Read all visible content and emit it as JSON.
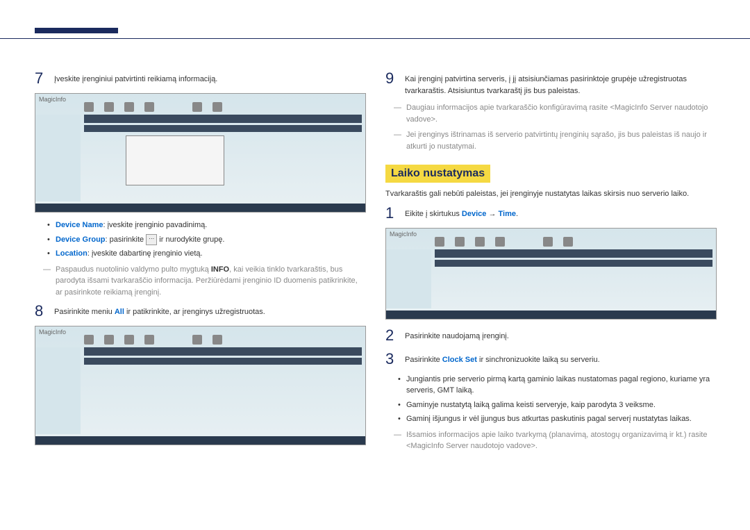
{
  "left": {
    "s7": {
      "num": "7",
      "txt": "Įveskite įrenginiui patvirtinti reikiamą informaciją."
    },
    "b1_a": "Device Name",
    "b1_b": ": įveskite įrenginio pavadinimą.",
    "b2_a": "Device Group",
    "b2_b": ": pasirinkite ",
    "b2_c": " ir nurodykite grupę.",
    "b3_a": "Location",
    "b3_b": ": įveskite dabartinę įrenginio vietą.",
    "n1_a": "Paspaudus nuotolinio valdymo pulto mygtuką ",
    "n1_b": "INFO",
    "n1_c": ", kai veikia tinklo tvarkaraštis, bus parodyta išsami tvarkaraščio informacija. Peržiūrėdami įrenginio ID duomenis patikrinkite, ar pasirinkote reikiamą įrenginį.",
    "s8": {
      "num": "8",
      "txt_a": "Pasirinkite meniu ",
      "txt_b": "All",
      "txt_c": " ir patikrinkite, ar įrenginys užregistruotas."
    }
  },
  "right": {
    "s9": {
      "num": "9",
      "txt": "Kai įrenginį patvirtina serveris, į jį atsisiunčiamas pasirinktoje grupėje užregistruotas tvarkaraštis. Atsisiuntus tvarkaraštį jis bus paleistas."
    },
    "n2": "Daugiau informacijos apie tvarkaraščio konfigūravimą rasite <MagicInfo Server naudotojo vadove>.",
    "n3": "Jei įrenginys ištrinamas iš serverio patvirtintų įrenginių sąrašo, jis bus paleistas iš naujo ir atkurti jo nustatymai.",
    "hdr": "Laiko nustatymas",
    "intro": "Tvarkaraštis gali nebūti paleistas, jei įrenginyje nustatytas laikas skirsis nuo serverio laiko.",
    "s1": {
      "num": "1",
      "a": "Eikite į skirtukus ",
      "b": "Device",
      "c": " → ",
      "d": "Time",
      "e": "."
    },
    "s2": {
      "num": "2",
      "txt": "Pasirinkite naudojamą įrenginį."
    },
    "s3": {
      "num": "3",
      "a": "Pasirinkite ",
      "b": "Clock Set",
      "c": " ir sinchronizuokite laiką su serveriu."
    },
    "b4": "Jungiantis prie serverio pirmą kartą gaminio laikas nustatomas pagal regiono, kuriame yra serveris, GMT laiką.",
    "b5": "Gaminyje nustatytą laiką galima keisti serveryje, kaip parodyta 3 veiksme.",
    "b6": "Gaminį išjungus ir vėl įjungus bus atkurtas paskutinis pagal serverį nustatytas laikas.",
    "n4": "Išsamios informacijos apie laiko tvarkymą (planavimą, atostogų organizavimą ir kt.) rasite <MagicInfo Server naudotojo vadove>."
  }
}
